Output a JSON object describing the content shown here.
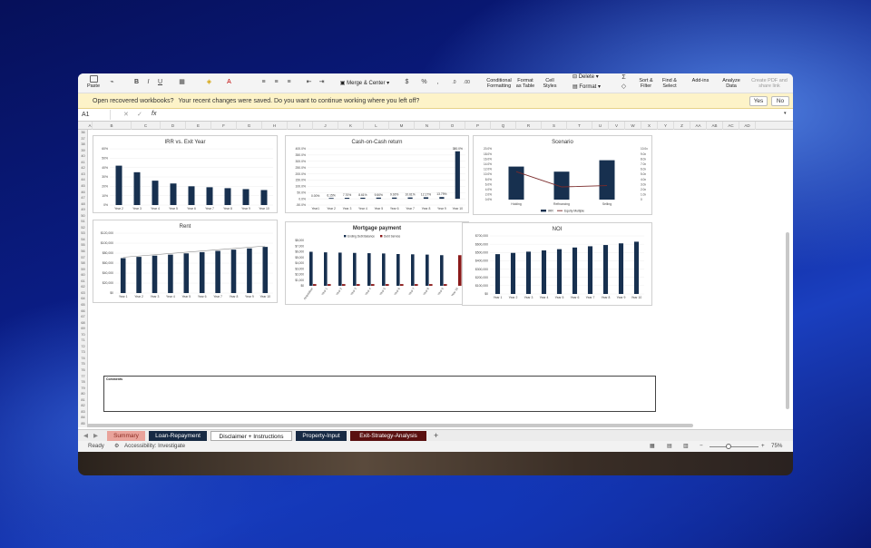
{
  "ribbon": {
    "paste": "Paste",
    "merge_center": "Merge & Center",
    "conditional": "Conditional Formatting",
    "format_table": "Format as Table",
    "cell_styles": "Cell Styles",
    "delete": "Delete",
    "format": "Format",
    "sort_filter": "Sort & Filter",
    "find_select": "Find & Select",
    "addins": "Add-ins",
    "analyze": "Analyze Data",
    "create_pdf": "Create PDF and share link"
  },
  "infobar": {
    "title": "Open recovered workbooks?",
    "message": "Your recent changes were saved. Do you want to continue working where you left off?",
    "yes": "Yes",
    "no": "No"
  },
  "formula_bar": {
    "name_box": "A1",
    "fx": "fx"
  },
  "col_letters": [
    "A",
    "B",
    "C",
    "D",
    "E",
    "F",
    "G",
    "H",
    "I",
    "J",
    "K",
    "L",
    "M",
    "N",
    "O",
    "P",
    "Q",
    "R",
    "S",
    "T",
    "U",
    "V",
    "W",
    "X",
    "Y",
    "Z",
    "AA",
    "AB",
    "AC",
    "AD"
  ],
  "row_start": 36,
  "row_count": 50,
  "comments_label": "Comments",
  "tabs": [
    {
      "label": "Summary",
      "bg": "#e9a39b",
      "fg": "#8a2a20"
    },
    {
      "label": "Loan-Repayment",
      "bg": "#172a44",
      "fg": "#ffffff"
    },
    {
      "label": "Disclaimer + Instructions",
      "bg": "#ffffff",
      "fg": "#111111"
    },
    {
      "label": "Property-Input",
      "bg": "#172a44",
      "fg": "#ffffff"
    },
    {
      "label": "Exit-Strategy-Analysis",
      "bg": "#5a1010",
      "fg": "#ffffff"
    }
  ],
  "add_tab": "+",
  "status": {
    "ready": "Ready",
    "accessibility": "Accessibility: Investigate",
    "zoom": "75%"
  },
  "colors": {
    "bar": "#17304f",
    "bar_red": "#8b1a1a",
    "line": "#7a2a2a",
    "ribbon_bg": "#f4f4f4",
    "info_bg": "#fdf3c8"
  },
  "chart_data": [
    {
      "type": "bar",
      "title": "IRR vs. Exit Year",
      "categories": [
        "Year 2",
        "Year 3",
        "Year 4",
        "Year 5",
        "Year 6",
        "Year 7",
        "Year 8",
        "Year 9",
        "Year 10"
      ],
      "values": [
        42,
        35,
        26,
        23,
        20,
        19,
        18,
        17,
        16
      ],
      "ylim": [
        0,
        60
      ],
      "ticks": [
        "0%",
        "10%",
        "20%",
        "30%",
        "40%",
        "50%",
        "60%"
      ]
    },
    {
      "type": "bar",
      "title": "Cash-on-Cash return",
      "categories": [
        "Year1",
        "Year 2",
        "Year 3",
        "Year 4",
        "Year 5",
        "Year 6",
        "Year 7",
        "Year 8",
        "Year 9",
        "Year 10"
      ],
      "values": [
        0,
        6.15,
        7.7,
        8.61,
        9.5,
        9.92,
        10.61,
        12.17,
        13.79,
        380.0
      ],
      "labels": [
        "0.00%",
        "6.15%",
        "7.70%",
        "8.61%",
        "9.50%",
        "9.92%",
        "10.61%",
        "12.17%",
        "13.79%",
        "380.0%"
      ],
      "ylim": [
        -50,
        400
      ],
      "ticks": [
        "-50.0%",
        "0.0%",
        "50.0%",
        "100.0%",
        "150.0%",
        "200.0%",
        "250.0%",
        "300.0%",
        "350.0%",
        "400.0%"
      ]
    },
    {
      "type": "bar",
      "title": "Scenario",
      "categories": [
        "Holding",
        "Refinancing",
        "Selling"
      ],
      "series": [
        {
          "name": "IRR",
          "values": [
            13.0,
            11.0,
            15.5
          ]
        },
        {
          "name": "Equity Multiple",
          "values": [
            11.0,
            5.0,
            5.5
          ]
        }
      ],
      "ylim": [
        0,
        20
      ],
      "ticks": [
        "0.0%",
        "2.0%",
        "4.0%",
        "6.0%",
        "8.0%",
        "10.0%",
        "12.0%",
        "14.0%",
        "16.0%",
        "18.0%",
        "20.0%"
      ],
      "ticks_right": [
        "0",
        "1.0x",
        "2.0x",
        "3.0x",
        "4.0x",
        "5.0x",
        "6.0x",
        "7.0x",
        "8.0x",
        "9.0x",
        "10.0x"
      ]
    },
    {
      "type": "bar",
      "title": "Rent",
      "categories": [
        "Year 1",
        "Year 2",
        "Year 3",
        "Year 4",
        "Year 5",
        "Year 6",
        "Year 7",
        "Year 8",
        "Year 9",
        "Year 10"
      ],
      "values": [
        70000,
        72500,
        75000,
        77000,
        79500,
        82000,
        84500,
        87000,
        89500,
        92500
      ],
      "ylim": [
        0,
        120000
      ],
      "ticks": [
        "$0",
        "$20,000",
        "$40,000",
        "$60,000",
        "$80,000",
        "$100,000",
        "$120,000"
      ]
    },
    {
      "type": "bar",
      "title": "Mortgage payment",
      "categories": [
        "Acquisition",
        "Year 1",
        "Year 2",
        "Year 3",
        "Year 4",
        "Year 5",
        "Year 6",
        "Year 7",
        "Year 8",
        "Year 9",
        "Year 10"
      ],
      "series": [
        {
          "name": "Ending Debt Balance",
          "values": [
            6000000,
            5900000,
            5850000,
            5800000,
            5750000,
            5700000,
            5600000,
            5550000,
            5500000,
            5400000,
            0
          ]
        },
        {
          "name": "Debt Service",
          "values": [
            300000,
            300000,
            300000,
            300000,
            300000,
            300000,
            300000,
            300000,
            300000,
            300000,
            5400000
          ]
        }
      ],
      "ylim": [
        0,
        8000000
      ],
      "ticks": [
        "$0",
        "$1,000",
        "$2,000",
        "$3,000",
        "$4,000",
        "$5,000",
        "$6,000",
        "$7,000",
        "$8,000"
      ]
    },
    {
      "type": "bar",
      "title": "NOI",
      "categories": [
        "Year 1",
        "Year 2",
        "Year 3",
        "Year 4",
        "Year 5",
        "Year 6",
        "Year 7",
        "Year 8",
        "Year 9",
        "Year 10"
      ],
      "values": [
        480000,
        495000,
        510000,
        525000,
        540000,
        560000,
        575000,
        590000,
        610000,
        630000
      ],
      "ylim": [
        0,
        700000
      ],
      "ticks": [
        "$0",
        "$100,000",
        "$200,000",
        "$300,000",
        "$400,000",
        "$500,000",
        "$600,000",
        "$700,000"
      ]
    }
  ]
}
